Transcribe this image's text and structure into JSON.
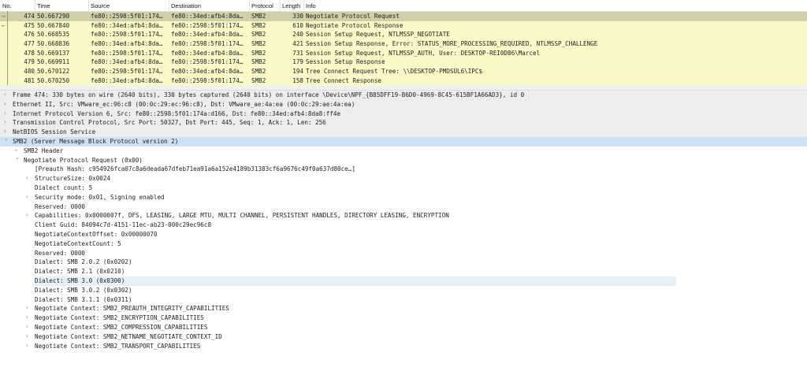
{
  "packet_list": {
    "columns": [
      "No.",
      "Time",
      "Source",
      "Destination",
      "Protocol",
      "Length",
      "Info"
    ],
    "rows": [
      {
        "no": "474",
        "time": "50.667290",
        "src": "fe80::2598:5f01:174…",
        "dst": "fe80::34ed:afb4:8da…",
        "proto": "SMB2",
        "len": "330",
        "info": "Negotiate Protocol Request",
        "selected": true,
        "marker": "→"
      },
      {
        "no": "475",
        "time": "50.667840",
        "src": "fe80::34ed:afb4:8da…",
        "dst": "fe80::2598:5f01:174…",
        "proto": "SMB2",
        "len": "610",
        "info": "Negotiate Protocol Response",
        "marker": "←"
      },
      {
        "no": "476",
        "time": "50.668535",
        "src": "fe80::2598:5f01:174…",
        "dst": "fe80::34ed:afb4:8da…",
        "proto": "SMB2",
        "len": "240",
        "info": "Session Setup Request, NTLMSSP_NEGOTIATE"
      },
      {
        "no": "477",
        "time": "50.668836",
        "src": "fe80::34ed:afb4:8da…",
        "dst": "fe80::2598:5f01:174…",
        "proto": "SMB2",
        "len": "421",
        "info": "Session Setup Response, Error: STATUS_MORE_PROCESSING_REQUIRED, NTLMSSP_CHALLENGE"
      },
      {
        "no": "478",
        "time": "50.669137",
        "src": "fe80::2598:5f01:174…",
        "dst": "fe80::34ed:afb4:8da…",
        "proto": "SMB2",
        "len": "731",
        "info": "Session Setup Request, NTLMSSP_AUTH, User: DESKTOP-REI0D86\\Marcel"
      },
      {
        "no": "479",
        "time": "50.669911",
        "src": "fe80::34ed:afb4:8da…",
        "dst": "fe80::2598:5f01:174…",
        "proto": "SMB2",
        "len": "179",
        "info": "Session Setup Response"
      },
      {
        "no": "480",
        "time": "50.670122",
        "src": "fe80::2598:5f01:174…",
        "dst": "fe80::34ed:afb4:8da…",
        "proto": "SMB2",
        "len": "194",
        "info": "Tree Connect Request Tree: \\\\DESKTOP-PMDSUL6\\IPC$"
      },
      {
        "no": "481",
        "time": "50.670250",
        "src": "fe80::34ed:afb4:8da…",
        "dst": "fe80::2598:5f01:174…",
        "proto": "SMB2",
        "len": "158",
        "info": "Tree Connect Response"
      }
    ]
  },
  "details": [
    {
      "level": 0,
      "arrow": "collapsed",
      "text": "Frame 474: 330 bytes on wire (2640 bits), 330 bytes captured (2640 bits) on interface \\Device\\NPF_{B85DFF19-B6D0-4969-8C45-615BF1A66AD3}, id 0"
    },
    {
      "level": 0,
      "arrow": "collapsed",
      "text": "Ethernet II, Src: VMware_ec:96:c8 (00:0c:29:ec:96:c8), Dst: VMware_ae:4a:ea (00:0c:29:ae:4a:ea)"
    },
    {
      "level": 0,
      "arrow": "collapsed",
      "text": "Internet Protocol Version 6, Src: fe80::2598:5f01:174a:d166, Dst: fe80::34ed:afb4:8da8:ff4e"
    },
    {
      "level": 0,
      "arrow": "collapsed",
      "text": "Transmission Control Protocol, Src Port: 50327, Dst Port: 445, Seq: 1, Ack: 1, Len: 256"
    },
    {
      "level": 0,
      "arrow": "collapsed",
      "text": "NetBIOS Session Service"
    },
    {
      "level": 0,
      "arrow": "expanded",
      "text": "SMB2 (Server Message Block Protocol version 2)",
      "selected": true
    },
    {
      "level": 1,
      "arrow": "collapsed",
      "text": "SMB2 Header"
    },
    {
      "level": 1,
      "arrow": "expanded",
      "text": "Negotiate Protocol Request (0x00)"
    },
    {
      "level": 2,
      "arrow": "none",
      "text": "[Preauth Hash: c954926fca07c8a6deada67dfeb71ea91a6a152e4189b31383cf6a9676c49f0a637d80ce…]"
    },
    {
      "level": 2,
      "arrow": "collapsed",
      "text": "StructureSize: 0x0024"
    },
    {
      "level": 2,
      "arrow": "none",
      "text": "Dialect count: 5"
    },
    {
      "level": 2,
      "arrow": "collapsed",
      "text": "Security mode: 0x01, Signing enabled"
    },
    {
      "level": 2,
      "arrow": "none",
      "text": "Reserved: 0000"
    },
    {
      "level": 2,
      "arrow": "collapsed",
      "text": "Capabilities: 0x0000007f, DFS, LEASING, LARGE MTU, MULTI CHANNEL, PERSISTENT HANDLES, DIRECTORY LEASING, ENCRYPTION"
    },
    {
      "level": 2,
      "arrow": "none",
      "text": "Client Guid: 84094c7d-4151-11ec-ab23-000c29ec96c8"
    },
    {
      "level": 2,
      "arrow": "none",
      "text": "NegotiateContextOffset: 0x00000070"
    },
    {
      "level": 2,
      "arrow": "none",
      "text": "NegotiateContextCount: 5"
    },
    {
      "level": 2,
      "arrow": "none",
      "text": "Reserved: 0000"
    },
    {
      "level": 2,
      "arrow": "none",
      "text": "Dialect: SMB 2.0.2 (0x0202)"
    },
    {
      "level": 2,
      "arrow": "none",
      "text": "Dialect: SMB 2.1 (0x0210)"
    },
    {
      "level": 2,
      "arrow": "none",
      "text": "Dialect: SMB 3.0 (0x0300)",
      "hover": true
    },
    {
      "level": 2,
      "arrow": "none",
      "text": "Dialect: SMB 3.0.2 (0x0302)"
    },
    {
      "level": 2,
      "arrow": "none",
      "text": "Dialect: SMB 3.1.1 (0x0311)"
    },
    {
      "level": 2,
      "arrow": "collapsed",
      "text": "Negotiate Context: SMB2_PREAUTH_INTEGRITY_CAPABILITIES"
    },
    {
      "level": 2,
      "arrow": "collapsed",
      "text": "Negotiate Context: SMB2_ENCRYPTION_CAPABILITIES"
    },
    {
      "level": 2,
      "arrow": "collapsed",
      "text": "Negotiate Context: SMB2_COMPRESSION_CAPABILITIES"
    },
    {
      "level": 2,
      "arrow": "collapsed",
      "text": "Negotiate Context: SMB2_NETNAME_NEGOTIATE_CONTEXT_ID"
    },
    {
      "level": 2,
      "arrow": "collapsed",
      "text": "Negotiate Context: SMB2_TRANSPORT_CAPABILITIES"
    }
  ],
  "colors": {
    "row_bg": "#fafac8",
    "selected_row_bg": "#cfcfa8",
    "detail_selected_bg": "#cde0f4"
  }
}
